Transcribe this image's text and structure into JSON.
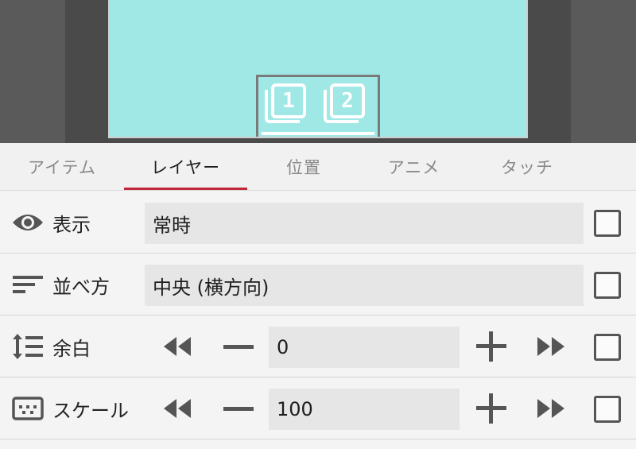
{
  "preview": {
    "widget_numbers": [
      "1",
      "2"
    ],
    "colors": {
      "stage": "#a0e8e6",
      "frame": "#4a4a4a"
    }
  },
  "tabs": [
    {
      "label": "アイテム",
      "active": false
    },
    {
      "label": "レイヤー",
      "active": true
    },
    {
      "label": "位置",
      "active": false
    },
    {
      "label": "アニメ",
      "active": false
    },
    {
      "label": "タッチ",
      "active": false
    }
  ],
  "rows": {
    "display": {
      "icon": "eye-icon",
      "label": "表示",
      "value": "常時"
    },
    "arrange": {
      "icon": "sort-lines-icon",
      "label": "並べ方",
      "value": "中央 (横方向)"
    },
    "margin": {
      "icon": "line-spacing-icon",
      "label": "余白",
      "value": "0"
    },
    "scale": {
      "icon": "dotted-frame-icon",
      "label": "スケール",
      "value": "100"
    }
  },
  "accent_color": "#c0283a"
}
